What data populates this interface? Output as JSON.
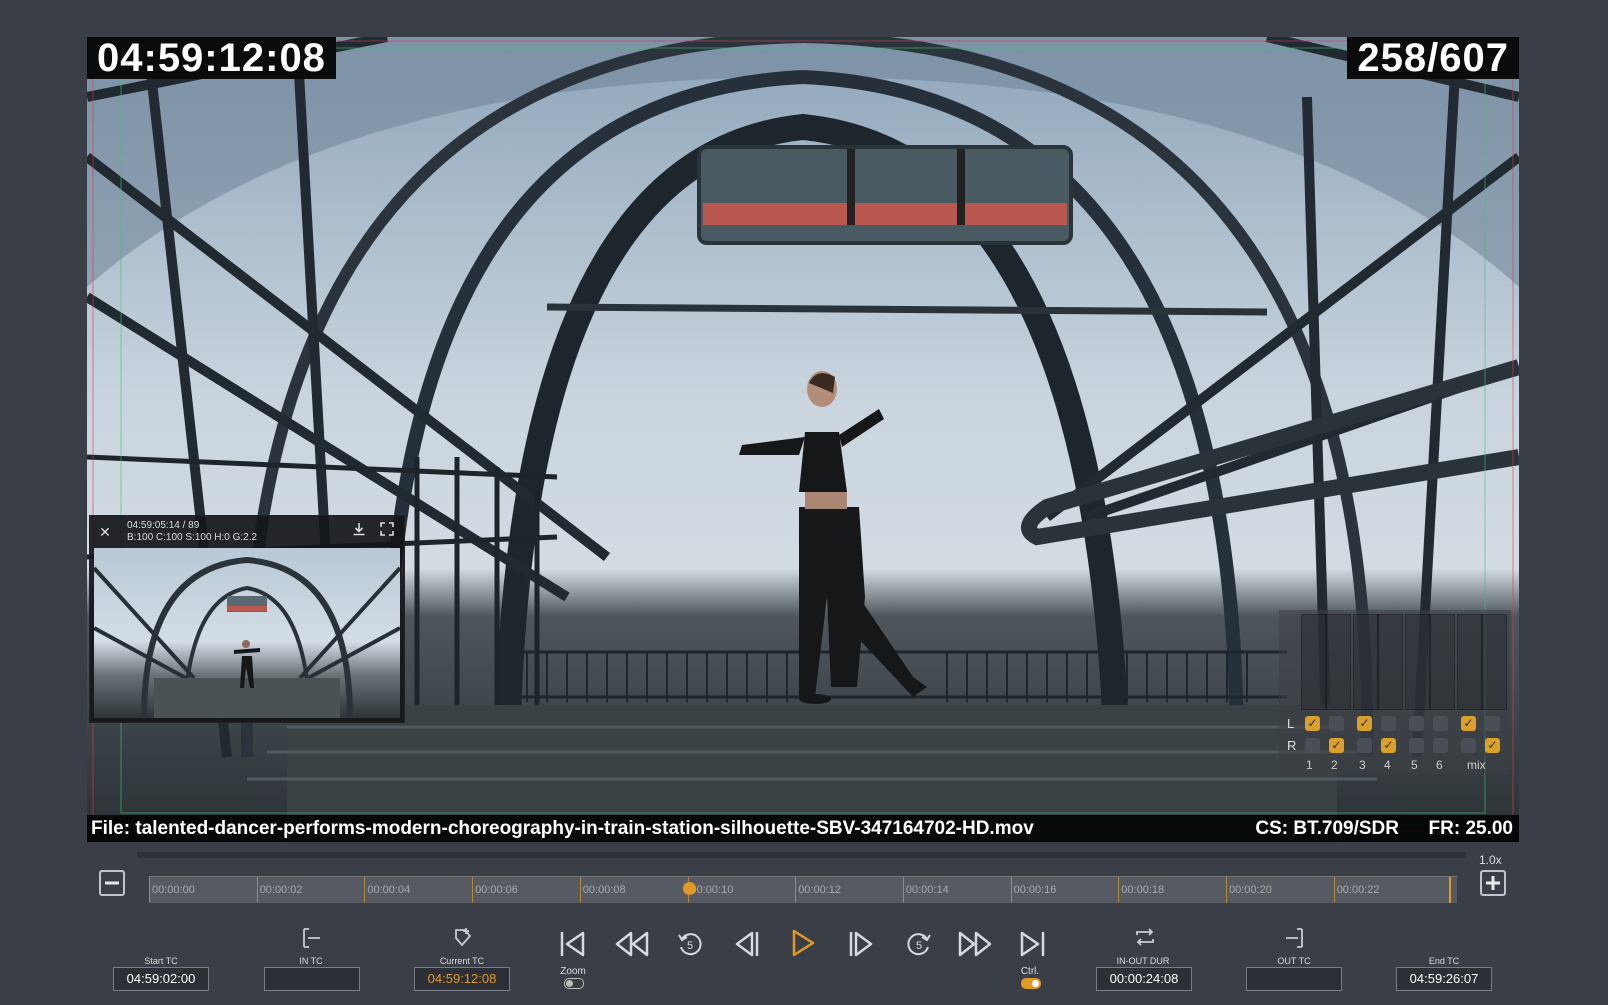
{
  "viewer": {
    "timecode": "04:59:12:08",
    "frame_counter": "258/607",
    "info": {
      "file": "File: talented-dancer-performs-modern-choreography-in-train-station-silhouette-SBV-347164702-HD.mov",
      "colorspace": "CS: BT.709/SDR",
      "framerate": "FR: 25.00"
    }
  },
  "pip": {
    "timecode": "04:59:05:14 / 89",
    "stats": "B:100 C:100 S:100 H:0 G:2.2"
  },
  "audio": {
    "row_labels": [
      "L",
      "R"
    ],
    "channels": [
      "1",
      "2",
      "3",
      "4",
      "5",
      "6",
      "mix"
    ],
    "left_checks": [
      true,
      false,
      true,
      false,
      false,
      false,
      true,
      false
    ],
    "right_checks": [
      false,
      true,
      false,
      true,
      false,
      false,
      false,
      true
    ]
  },
  "zoom": {
    "level": "1.0x"
  },
  "timeline": {
    "ticks": [
      "00:00:00",
      "00:00:02",
      "00:00:04",
      "00:00:06",
      "00:00:08",
      "00:00:10",
      "00:00:12",
      "00:00:14",
      "00:00:16",
      "00:00:18",
      "00:00:20",
      "00:00:22"
    ],
    "playhead_position": 0.413
  },
  "controls": {
    "start_tc": {
      "label": "Start TC",
      "value": "04:59:02:00"
    },
    "in_tc": {
      "label": "IN TC",
      "value": ""
    },
    "current_tc": {
      "label": "Current TC",
      "value": "04:59:12:08"
    },
    "in_out_dur": {
      "label": "IN-OUT DUR",
      "value": "00:00:24:08"
    },
    "out_tc": {
      "label": "OUT TC",
      "value": ""
    },
    "end_tc": {
      "label": "End TC",
      "value": "04:59:26:07"
    },
    "zoom_label": "Zoom",
    "ctrl_label": "Ctrl.",
    "rewind_5": "5",
    "forward_5": "5"
  },
  "colors": {
    "accent": "#e39a25",
    "background": "#3a3e47"
  },
  "icons": [
    "go-to-start-icon",
    "rewind-icon",
    "back-5-seconds-icon",
    "step-back-icon",
    "play-icon",
    "step-forward-icon",
    "forward-5-seconds-icon",
    "fast-forward-icon",
    "go-to-end-icon",
    "set-in-icon",
    "add-marker-icon",
    "loop-icon",
    "set-out-icon"
  ]
}
